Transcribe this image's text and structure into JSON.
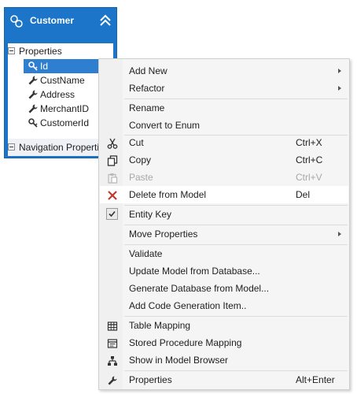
{
  "entity": {
    "title": "Customer",
    "icons": {
      "entity": "entity-icon",
      "collapse": "collapse-up-icon"
    },
    "sections": {
      "properties": "Properties",
      "navigation": "Navigation Properties"
    },
    "properties": [
      {
        "label": "Id",
        "icon": "key-icon",
        "selected": true
      },
      {
        "label": "CustName",
        "icon": "wrench-icon"
      },
      {
        "label": "Address",
        "icon": "wrench-icon"
      },
      {
        "label": "MerchantID",
        "icon": "wrench-icon"
      },
      {
        "label": "CustomerId",
        "icon": "key-icon"
      }
    ],
    "colors": {
      "header": "#1c75c8",
      "selection": "#2f7fd0"
    }
  },
  "menu": {
    "items": [
      {
        "label": "Add New",
        "submenu": true
      },
      {
        "label": "Refactor",
        "submenu": true
      },
      {
        "label": "Rename"
      },
      {
        "label": "Convert to Enum"
      },
      {
        "label": "Cut",
        "shortcut": "Ctrl+X",
        "icon": "scissors-icon"
      },
      {
        "label": "Copy",
        "shortcut": "Ctrl+C",
        "icon": "copy-icon"
      },
      {
        "label": "Paste",
        "shortcut": "Ctrl+V",
        "icon": "paste-icon",
        "disabled": true
      },
      {
        "label": "Delete from Model",
        "shortcut": "Del",
        "icon": "delete-x-icon",
        "hovered": true
      },
      {
        "label": "Entity Key",
        "icon": "checkmark-icon",
        "checked": true
      },
      {
        "label": "Move Properties",
        "submenu": true
      },
      {
        "label": "Validate"
      },
      {
        "label": "Update Model from Database..."
      },
      {
        "label": "Generate Database from Model..."
      },
      {
        "label": "Add Code Generation Item.."
      },
      {
        "label": "Table Mapping",
        "icon": "table-mapping-icon"
      },
      {
        "label": "Stored Procedure Mapping",
        "icon": "stored-procedure-icon"
      },
      {
        "label": "Show in Model Browser",
        "icon": "model-browser-icon"
      },
      {
        "label": "Properties",
        "shortcut": "Alt+Enter",
        "icon": "wrench-icon"
      }
    ],
    "colors": {
      "delete_icon": "#c0392b"
    }
  }
}
